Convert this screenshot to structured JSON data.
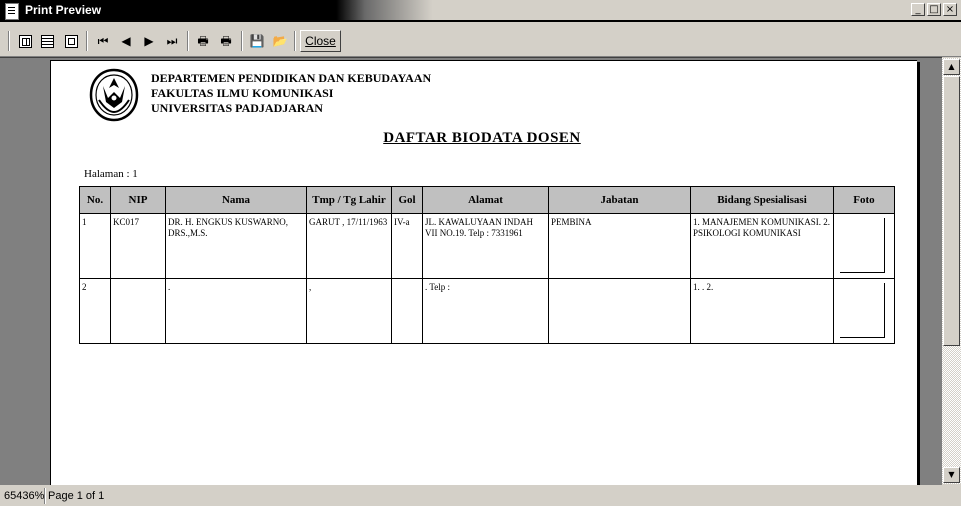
{
  "window": {
    "title": "Print Preview",
    "minimize": "_",
    "maximize": "□",
    "close": "×"
  },
  "toolbar": {
    "close_label": "Close"
  },
  "statusbar": {
    "zoom": "65436%",
    "page": "Page 1 of 1"
  },
  "report": {
    "header_lines": [
      "DEPARTEMEN PENDIDIKAN DAN KEBUDAYAAN",
      "FAKULTAS ILMU KOMUNIKASI",
      "UNIVERSITAS PADJADJARAN"
    ],
    "title": "DAFTAR BIODATA DOSEN",
    "halaman": "Halaman : 1",
    "columns": [
      "No.",
      "NIP",
      "Nama",
      "Tmp / Tg Lahir",
      "Gol",
      "Alamat",
      "Jabatan",
      "Bidang Spesialisasi",
      "Foto"
    ],
    "rows": [
      {
        "no": "1",
        "nip": "KC017",
        "nama": "DR. H. ENGKUS KUSWARNO, DRS.,M.S.",
        "lahir": "GARUT , 17/11/1963",
        "gol": "IV-a",
        "alamat": "JL. KAWALUYAAN INDAH VII NO.19. Telp : 7331961",
        "jabatan": "PEMBINA",
        "bidang": "1. MANAJEMEN KOMUNIKASI. 2. PSIKOLOGI KOMUNIKASI",
        "foto": ""
      },
      {
        "no": "2",
        "nip": "",
        "nama": ".",
        "lahir": ",",
        "gol": "",
        "alamat": ". Telp :",
        "jabatan": "",
        "bidang": "1. . 2.",
        "foto": ""
      }
    ]
  }
}
